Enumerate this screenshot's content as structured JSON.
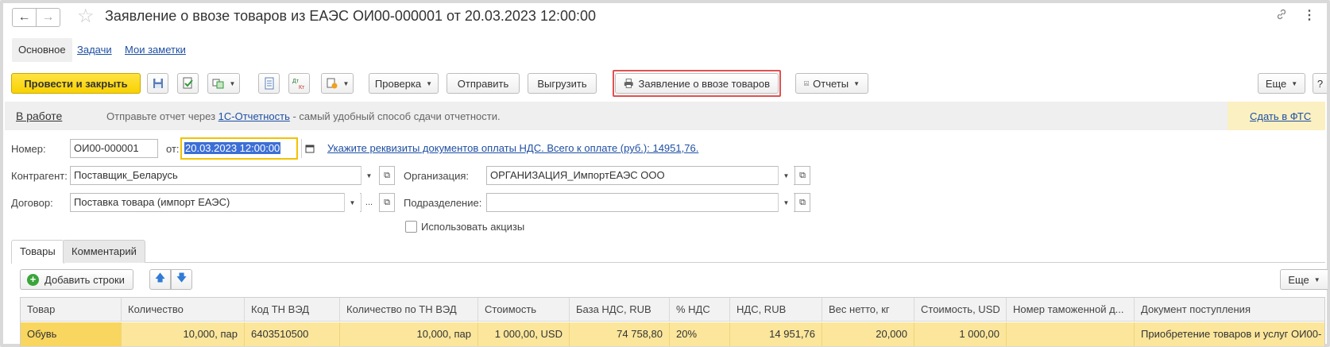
{
  "window": {
    "title": "Заявление о ввозе товаров из ЕАЭС ОИ00-000001 от 20.03.2023 12:00:00"
  },
  "nav": {
    "back_icon": "←",
    "forward_icon": "→",
    "favorite_icon": "☆",
    "link_icon": "🔗",
    "more_icon": "⋮"
  },
  "top_tabs": {
    "main": "Основное",
    "tasks": "Задачи",
    "notes": "Мои заметки"
  },
  "toolbar": {
    "post_close": "Провести и закрыть",
    "check": "Проверка",
    "send": "Отправить",
    "upload": "Выгрузить",
    "print_statement": "Заявление о ввозе товаров",
    "reports": "Отчеты",
    "more": "Еще",
    "help": "?"
  },
  "infobar": {
    "state": "В работе",
    "msg_prefix": "Отправьте отчет через ",
    "msg_link": "1С-Отчетность",
    "msg_suffix": " - самый удобный способ сдачи отчетности.",
    "fts_link": "Сдать в ФТС"
  },
  "form": {
    "number_label": "Номер:",
    "number_value": "ОИ00-000001",
    "date_label": "от:",
    "date_value": "20.03.2023 12:00:00",
    "vat_link": "Укажите реквизиты документов оплаты НДС. Всего к оплате (руб.): 14951,76.",
    "counterparty_label": "Контрагент:",
    "counterparty_value": "Поставщик_Беларусь",
    "contract_label": "Договор:",
    "contract_value": "Поставка товара (импорт ЕАЭС)",
    "org_label": "Организация:",
    "org_value": "ОРГАНИЗАЦИЯ_ИмпортЕАЭС ООО",
    "division_label": "Подразделение:",
    "division_value": "",
    "excise_label": "Использовать акцизы",
    "excise_checked": false
  },
  "tabs": {
    "goods": "Товары",
    "comment": "Комментарий"
  },
  "table_toolbar": {
    "add_rows": "Добавить строки",
    "more": "Еще"
  },
  "table": {
    "columns": [
      "Товар",
      "Количество",
      "Код ТН ВЭД",
      "Количество по ТН ВЭД",
      "Стоимость",
      "База НДС, RUB",
      "% НДС",
      "НДС, RUB",
      "Вес нетто, кг",
      "Стоимость, USD",
      "Номер таможенной д...",
      "Документ поступления"
    ],
    "rows": [
      [
        "Обувь",
        "10,000, пар",
        "6403510500",
        "10,000, пар",
        "1 000,00, USD",
        "74 758,80",
        "20%",
        "14 951,76",
        "20,000",
        "1 000,00",
        "",
        "Приобретение товаров и услуг ОИ00-"
      ]
    ]
  }
}
